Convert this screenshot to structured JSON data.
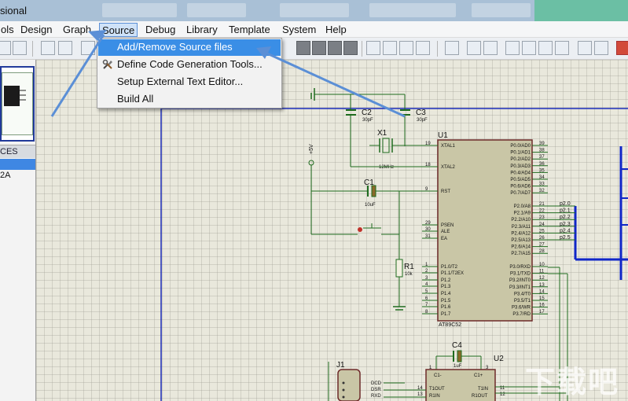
{
  "app": {
    "title_fragment": "sional"
  },
  "menu": {
    "items": [
      {
        "key": "tools",
        "label": "ols"
      },
      {
        "key": "design",
        "label": "Design"
      },
      {
        "key": "graph",
        "label": "Graph"
      },
      {
        "key": "source",
        "label": "Source"
      },
      {
        "key": "debug",
        "label": "Debug"
      },
      {
        "key": "library",
        "label": "Library"
      },
      {
        "key": "template",
        "label": "Template"
      },
      {
        "key": "system",
        "label": "System"
      },
      {
        "key": "help",
        "label": "Help"
      }
    ],
    "active": "Source"
  },
  "source_menu": {
    "items": [
      {
        "label": "Add/Remove Source files",
        "highlighted": true
      },
      {
        "label": "Define Code Generation Tools...",
        "icon": "tools-icon"
      },
      {
        "label": "Setup External Text Editor..."
      },
      {
        "label": "Build All"
      }
    ]
  },
  "left_panel": {
    "devices_header": "CES",
    "device_item": "2A"
  },
  "schematic": {
    "components": {
      "c2": {
        "ref": "C2",
        "value": "30pF"
      },
      "c3": {
        "ref": "C3",
        "value": "30pF"
      },
      "x1": {
        "ref": "X1",
        "value": "12MHz"
      },
      "c1": {
        "ref": "C1",
        "value": "10uF"
      },
      "r1": {
        "ref": "R1",
        "value": "10k"
      },
      "u1": {
        "ref": "U1",
        "part": "AT89C52"
      },
      "c4": {
        "ref": "C4",
        "value": "1uF"
      },
      "u2": {
        "ref": "U2"
      },
      "j1": {
        "ref": "J1"
      },
      "vcc": {
        "label": "+5V"
      }
    },
    "u1_left_pins": [
      {
        "num": "19",
        "name": "XTAL1"
      },
      {
        "num": "18",
        "name": "XTAL2"
      },
      {
        "num": "9",
        "name": "RST"
      },
      {
        "num": "29",
        "name": "PSEN"
      },
      {
        "num": "30",
        "name": "ALE"
      },
      {
        "num": "31",
        "name": "EA"
      },
      {
        "num": "1",
        "name": "P1.0/T2"
      },
      {
        "num": "2",
        "name": "P1.1/T2EX"
      },
      {
        "num": "3",
        "name": "P1.2"
      },
      {
        "num": "4",
        "name": "P1.3"
      },
      {
        "num": "5",
        "name": "P1.4"
      },
      {
        "num": "6",
        "name": "P1.5"
      },
      {
        "num": "7",
        "name": "P1.6"
      },
      {
        "num": "8",
        "name": "P1.7"
      }
    ],
    "u1_right_pins": [
      {
        "num": "39",
        "name": "P0.0/AD0"
      },
      {
        "num": "38",
        "name": "P0.1/AD1"
      },
      {
        "num": "37",
        "name": "P0.2/AD2"
      },
      {
        "num": "36",
        "name": "P0.3/AD3"
      },
      {
        "num": "35",
        "name": "P0.4/AD4"
      },
      {
        "num": "34",
        "name": "P0.5/AD5"
      },
      {
        "num": "33",
        "name": "P0.6/AD6"
      },
      {
        "num": "32",
        "name": "P0.7/AD7"
      },
      {
        "num": "21",
        "name": "P2.0/A8"
      },
      {
        "num": "22",
        "name": "P2.1/A9"
      },
      {
        "num": "23",
        "name": "P2.2/A10"
      },
      {
        "num": "24",
        "name": "P2.3/A11"
      },
      {
        "num": "25",
        "name": "P2.4/A12"
      },
      {
        "num": "26",
        "name": "P2.5/A13"
      },
      {
        "num": "27",
        "name": "P2.6/A14"
      },
      {
        "num": "28",
        "name": "P2.7/A15"
      },
      {
        "num": "10",
        "name": "P3.0/RXD"
      },
      {
        "num": "11",
        "name": "P3.1/TXD"
      },
      {
        "num": "12",
        "name": "P3.2/INT0"
      },
      {
        "num": "13",
        "name": "P3.3/INT1"
      },
      {
        "num": "14",
        "name": "P3.4/T0"
      },
      {
        "num": "15",
        "name": "P3.5/T1"
      },
      {
        "num": "16",
        "name": "P3.6/WR"
      },
      {
        "num": "17",
        "name": "P3.7/RD"
      }
    ],
    "p2_net_labels": [
      "p2.0",
      "p2.1",
      "p2.2",
      "p2.3",
      "p2.4",
      "p2.5"
    ],
    "u2_pins": [
      {
        "num": "1",
        "name": "C1+"
      },
      {
        "num": "3",
        "name": "C1-"
      },
      {
        "num": "14",
        "name": "T1OUT"
      },
      {
        "num": "13",
        "name": "R1IN"
      },
      {
        "num": "11",
        "name": "T1IN"
      },
      {
        "num": "12",
        "name": "R1OUT"
      }
    ],
    "j1_pins": [
      "DCD",
      "DSR",
      "RXD"
    ]
  },
  "watermark": "下载吧",
  "colors": {
    "menu_highlight": "#3a8ee6",
    "wire": "#1e6b1e",
    "chip_fill": "#c9c6a6",
    "bus": "#1026c8",
    "annotation_arrow": "#5b8fd6"
  }
}
